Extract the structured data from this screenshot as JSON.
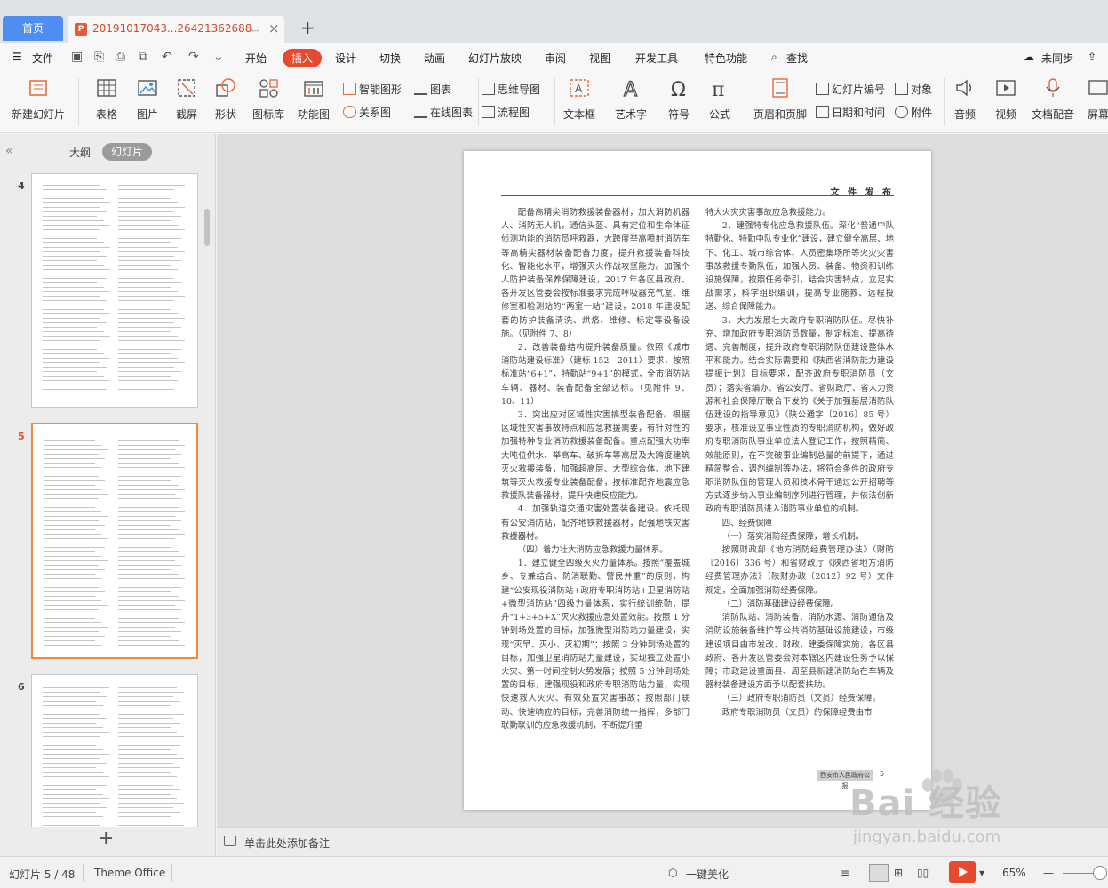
{
  "tabs": {
    "home": "首页",
    "document": "20191017043...26421362688"
  },
  "menu": {
    "file": "文件",
    "items": [
      "开始",
      "插入",
      "设计",
      "切换",
      "动画",
      "幻灯片放映",
      "审阅",
      "视图",
      "开发工具",
      "特色功能"
    ],
    "active": "插入",
    "search": "查找",
    "sync": "未同步"
  },
  "ribbon": {
    "new_slide": "新建幻灯片",
    "table": "表格",
    "picture": "图片",
    "screenshot": "截屏",
    "shape": "形状",
    "icon_lib": "图标库",
    "function_chart": "功能图",
    "smart_art": "智能图形",
    "chart": "图表",
    "relation": "关系图",
    "online_chart": "在线图表",
    "mind_map": "思维导图",
    "flowchart": "流程图",
    "textbox": "文本框",
    "wordart": "艺术字",
    "symbol": "符号",
    "formula": "公式",
    "header_footer": "页眉和页脚",
    "slide_number": "幻灯片编号",
    "date_time": "日期和时间",
    "object": "对象",
    "attachment": "附件",
    "audio": "音频",
    "video": "视频",
    "doc_dub": "文档配音",
    "screen_rec": "屏幕"
  },
  "panel": {
    "outline": "大纲",
    "slides": "幻灯片",
    "slide_numbers": [
      "4",
      "5",
      "6"
    ]
  },
  "page": {
    "header": "文 件 发 布",
    "left_col": [
      "配备高精尖消防救援装备器材，加大消防机器人、消防无人机，通信头盔、具有定位和生命体征侦测功能的消防员呼救器，大跨度举高喷射消防车等高精尖器材装备配备力度，提升救援装备科技化、智能化水平，增强灭火作战攻坚能力。加强个人防护装备保养保障建设，2017 年各区县政府、各开发区管委会按标准要求完成呼吸器充气室、维修室和检测站的“两室一站”建设，2018 年建设配套的防护装备清洗、烘烙、维修、标定等设备设施。（见附件 7、8）",
      "2．改善装备结构提升装备质量。依照《城市消防站建设标准》（建标 152—2011）要求，按照标准站“6+1”，特勤站“9+1”的模式，全市消防站车辆、器材、装备配备全部达标。（见附件 9、10、11）",
      "3．突出应对区域性灾害搞型装备配备。根据区域性灾害事故特点和应急救援需要，有针对性的加强特种专业消防救援装备配备。重点配强大功率大吨位供水、举高车、破拆车等高层及大跨度建筑灭火救援装备，加强超高层、大型综合体、地下建筑等灭火救援专业装备配备，按标准配齐地震应急救援队装备器材，提升快速反应能力。",
      "4．加强轨道交通灾害处置装备建设。依托现有公安消防站，配齐地铁救援器材，配强地铁灾害救援器材。",
      "（四）着力壮大消防应急救援力量体系。",
      "1．建立健全四级灭火力量体系。按照“覆盖城乡、专兼结合、防消联勤、警民并重”的原则，构建“公安现役消防站+政府专职消防站+卫星消防站+微型消防站”四级力量体系，实行统训统勤，提升“1+3+5+X”灭火救援应急处置效能。按照 1 分钟到场处置的目标，加强微型消防站力量建设，实现“灭早、灭小、灭初期”；按照 3 分钟到场处置的目标，加强卫星消防站力量建设，实现独立处置小火灾、第一时间控制火势发展；按照 5 分钟到场处置的目标，建强现役和政府专职消防站力量，实现快速救人灭火、有效处置灾害事故；按照部门联动、快速响应的目标，完善消防统一指挥，多部门联勤联训的应急救援机制，不断提升重"
    ],
    "right_col": [
      "特大火灾灾害事故应急救援能力。",
      "2．建强特专化应急救援队伍。深化“普通中队特勤化、特勤中队专业化”建设，建立健全高层、地下、化工、城市综合体、人员密集场所等火灾灾害事故救援专勤队伍，加强人员、装备、物资和训练设施保障，按照任务牵引，结合灾害特点，立足实战需求，科学组织编训，提高专业施救、远程投送、综合保障能力。",
      "3．大力发展壮大政府专职消防队伍。尽快补充、增加政府专职消防员数量，制定标准、提高待遇、完善制度，提升政府专职消防队伍建设整体水平和能力。结合实际需要和《陕西省消防能力建设提振计划》目标要求，配齐政府专职消防员（文员）；落实省编办、省公安厅、省财政厅、省人力资源和社会保障厅联合下发的《关于加强基层消防队伍建设的指导意见》（陕公通字〔2016〕85 号）要求，核准设立事业性质的专职消防机构，做好政府专职消防队事业单位法人登记工作，按照精简、效能原则，在不突破事业编制总量的前提下，通过精简整合，调剂编制等办法，将符合条件的政府专职消防队伍的管理人员和技术骨干通过公开招聘等方式逐步纳入事业编制序列进行管理，并依法创新政府专职消防员进入消防事业单位的机制。",
      "四、经费保障",
      "（一）落实消防经费保障，增长机制。",
      "按照财政部《地方消防经费管理办法》（财防〔2016〕336 号）和省财政厅《陕西省地方消防经费管理办法》（陕财办政〔2012〕92 号）文件规定，全面加强消防经费保障。",
      "（二）消防基础建设经费保障。",
      "消防队站、消防装备、消防水源、消防通信及消防设施装备维护等公共消防基础设施建设，市级建设项目由市发改、财政、建委保障实施，各区县政府、各开发区管委会对本辖区内建设任务予以保障；市政建设重面县、周至县新建消防站在车辆及器材装备建设方面予以配套扶助。",
      "（三）政府专职消防员（文员）经费保障。",
      "政府专职消防员（文员）的保障经费由市"
    ],
    "footer_label": "西安市人民政府公报",
    "footer_page": "5"
  },
  "notes": "单击此处添加备注",
  "status": {
    "slide_info": "幻灯片 5 / 48",
    "theme": "Theme Office",
    "beautify": "一键美化",
    "zoom": "65%"
  },
  "watermark": {
    "brand": "Bai  经验",
    "url": "jingyan.baidu.com"
  },
  "colors": {
    "accent": "#e64a2e",
    "home_tab": "#4d8ef0",
    "active_thumb_border": "#f08a3c"
  }
}
